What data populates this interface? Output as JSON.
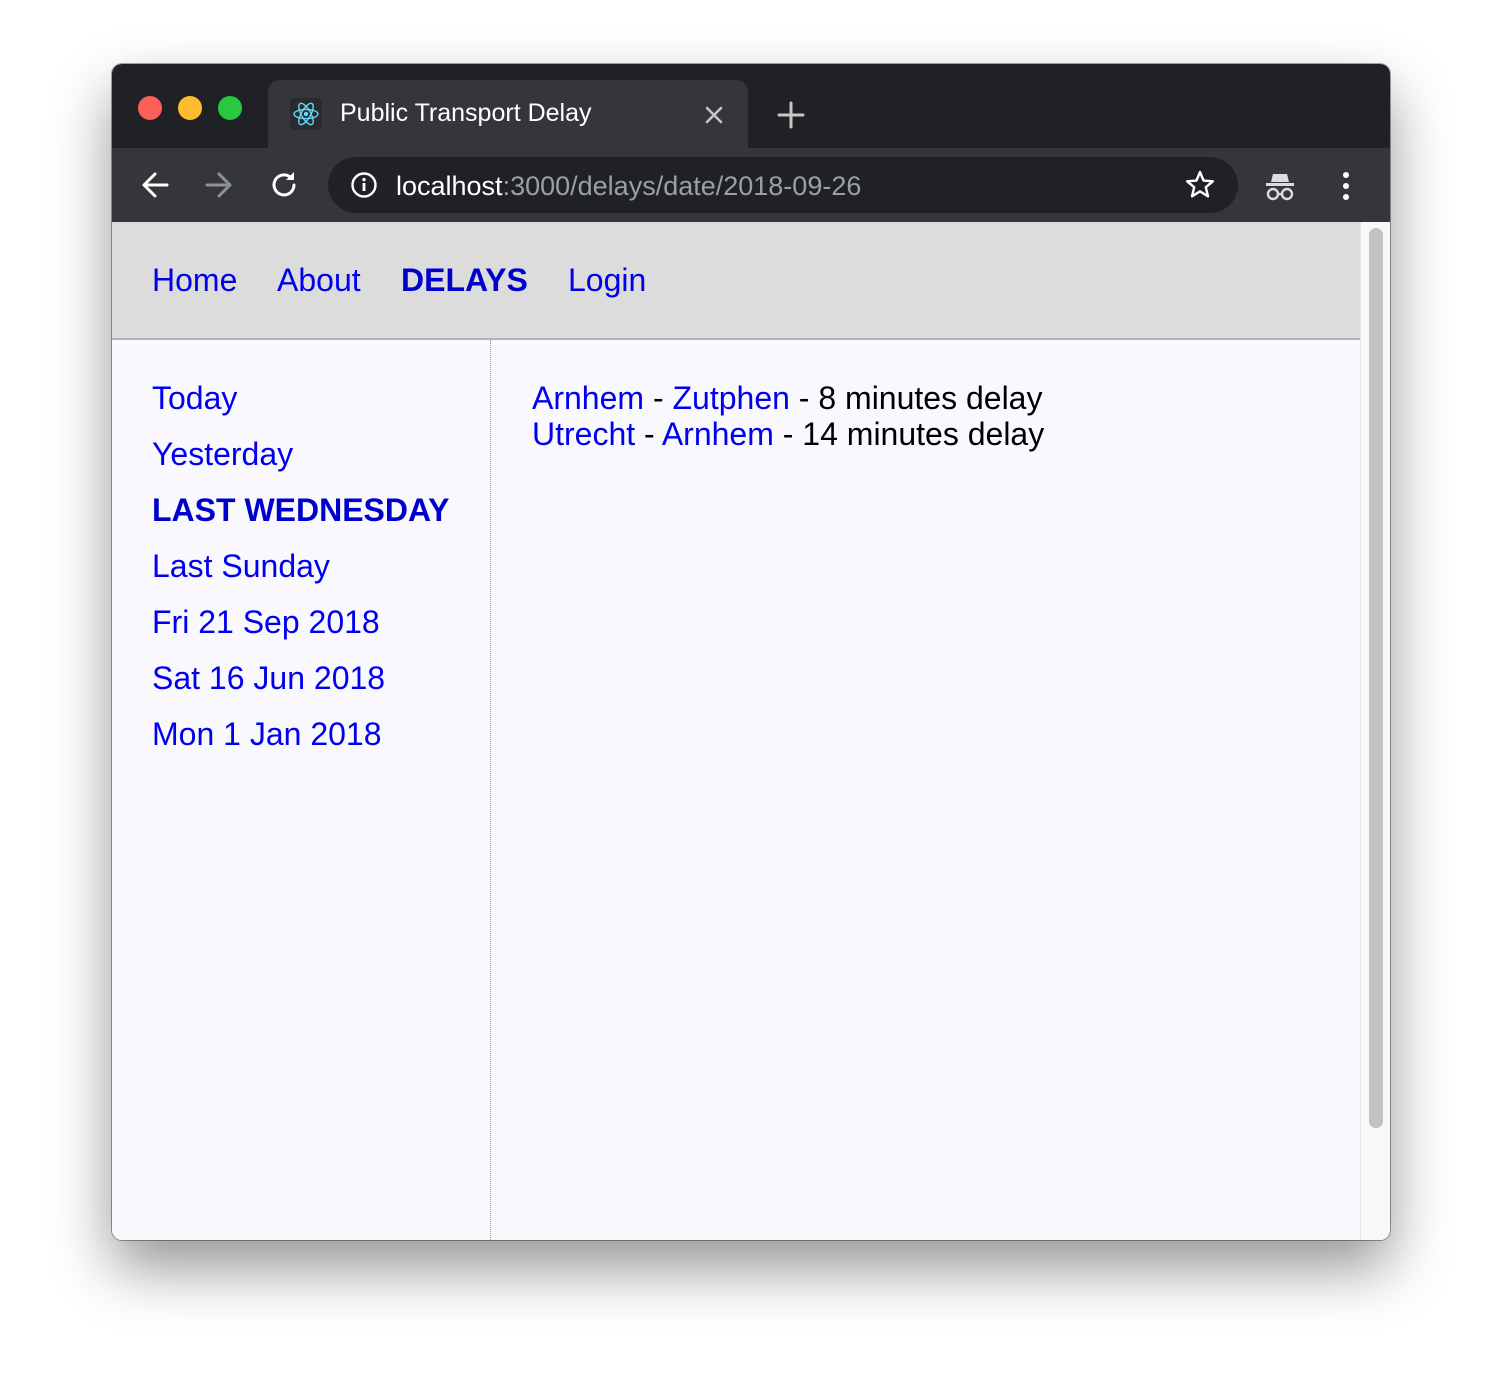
{
  "browser": {
    "tab": {
      "title": "Public Transport Delay",
      "favicon": "react-icon"
    },
    "url": {
      "host": "localhost",
      "rest": ":3000/delays/date/2018-09-26"
    }
  },
  "site_nav": {
    "items": [
      {
        "label": "Home",
        "active": false
      },
      {
        "label": "About",
        "active": false
      },
      {
        "label": "DELAYS",
        "active": true
      },
      {
        "label": "Login",
        "active": false
      }
    ]
  },
  "sidebar": {
    "items": [
      {
        "label": "Today",
        "active": false
      },
      {
        "label": "Yesterday",
        "active": false
      },
      {
        "label": "LAST WEDNESDAY",
        "active": true
      },
      {
        "label": "Last Sunday",
        "active": false
      },
      {
        "label": "Fri 21 Sep 2018",
        "active": false
      },
      {
        "label": "Sat 16 Jun 2018",
        "active": false
      },
      {
        "label": "Mon 1 Jan 2018",
        "active": false
      }
    ]
  },
  "delays": [
    {
      "from": "Arnhem",
      "to": "Zutphen",
      "separator": " - ",
      "detail": " - 8 minutes delay"
    },
    {
      "from": "Utrecht",
      "to": "Arnhem",
      "separator": " - ",
      "detail": " - 14 minutes delay"
    }
  ],
  "colors": {
    "link": "#0000ee",
    "active_link": "#0000cc",
    "nav_background": "#dcdcdc",
    "page_background": "#f8f8fd"
  }
}
